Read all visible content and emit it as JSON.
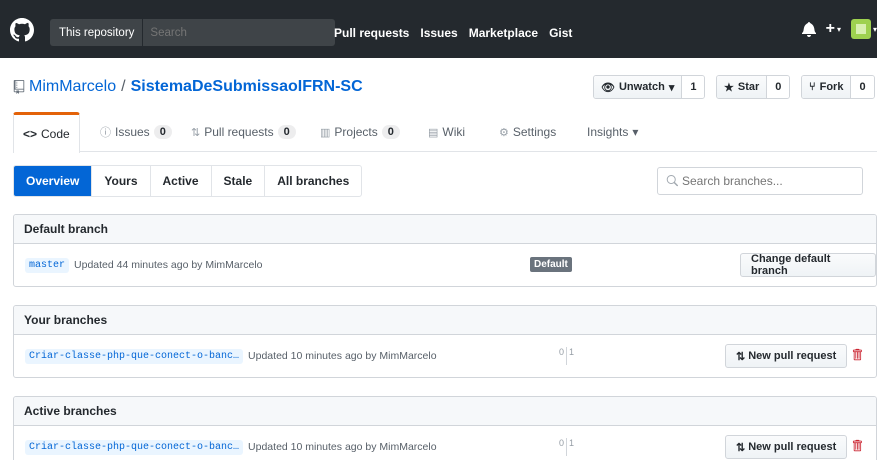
{
  "header": {
    "scope_label": "This repository",
    "search_placeholder": "Search",
    "nav": [
      "Pull requests",
      "Issues",
      "Marketplace",
      "Gist"
    ],
    "plus": "+"
  },
  "repo": {
    "owner": "MimMarcelo",
    "separator": "/",
    "name": "SistemaDeSubmissaoIFRN-SC",
    "watch_label": "Unwatch",
    "watch_count": "1",
    "star_label": "Star",
    "star_count": "0",
    "fork_label": "Fork",
    "fork_count": "0"
  },
  "tabs": {
    "code": "Code",
    "issues": "Issues",
    "issues_count": "0",
    "pulls": "Pull requests",
    "pulls_count": "0",
    "projects": "Projects",
    "projects_count": "0",
    "wiki": "Wiki",
    "settings": "Settings",
    "insights": "Insights"
  },
  "subnav": {
    "overview": "Overview",
    "yours": "Yours",
    "active": "Active",
    "stale": "Stale",
    "all": "All branches",
    "search_placeholder": "Search branches..."
  },
  "default_branch": {
    "header": "Default branch",
    "branch": "master",
    "updated": "Updated 44 minutes ago by MimMarcelo",
    "label": "Default",
    "button": "Change default branch"
  },
  "your_branches": {
    "header": "Your branches",
    "branch": "Criar-classe-php-que-conect-o-banc…",
    "updated": "Updated 10 minutes ago by MimMarcelo",
    "behind": "0",
    "ahead": "1",
    "button": "New pull request"
  },
  "active_branches": {
    "header": "Active branches",
    "branch": "Criar-classe-php-que-conect-o-banc…",
    "updated": "Updated 10 minutes ago by MimMarcelo",
    "behind": "0",
    "ahead": "1",
    "button": "New pull request"
  },
  "colors": {
    "header_bg": "#24292e",
    "link": "#0366d6",
    "tab_accent": "#e36209",
    "delete": "#cb2431"
  }
}
